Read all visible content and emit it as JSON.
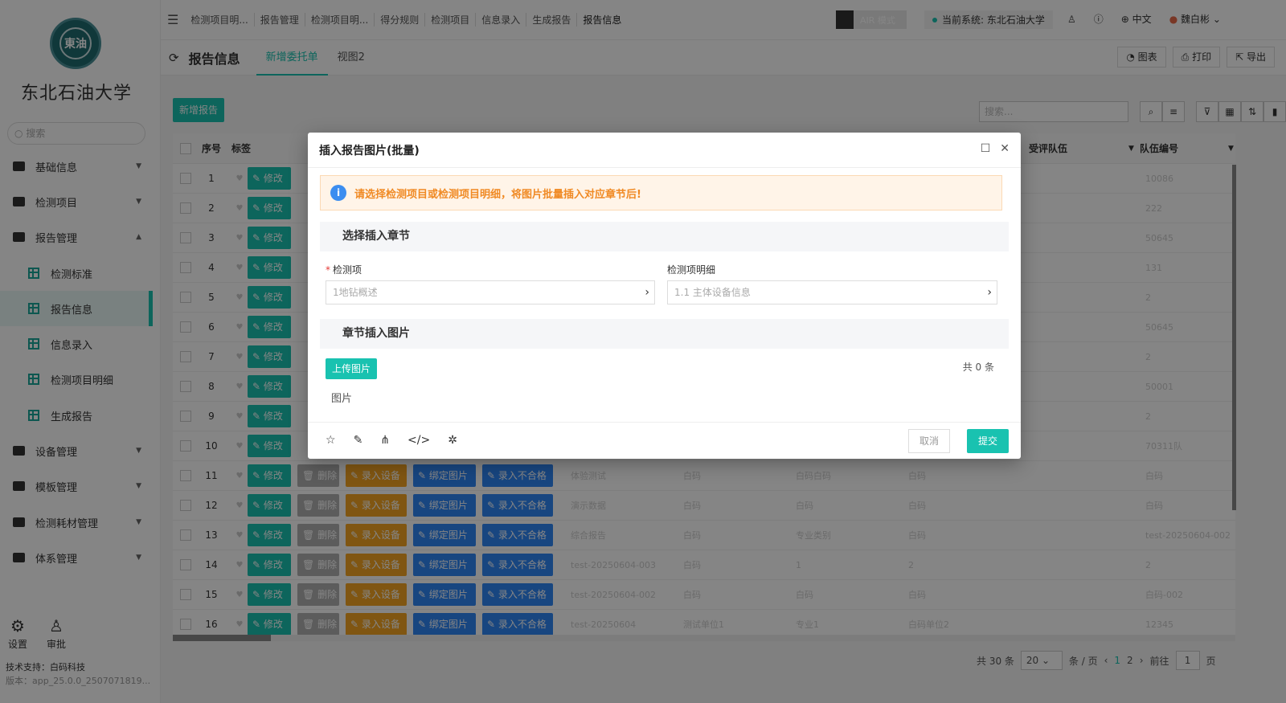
{
  "sidebar": {
    "logo_text": "東油",
    "university": "东北石油大学",
    "search_placeholder": "搜索",
    "menu": [
      {
        "label": "基础信息"
      },
      {
        "label": "检测项目"
      },
      {
        "label": "报告管理"
      },
      {
        "label": "设备管理"
      },
      {
        "label": "模板管理"
      },
      {
        "label": "检测耗材管理"
      },
      {
        "label": "体系管理"
      }
    ],
    "submenu": [
      {
        "label": "检测标准"
      },
      {
        "label": "报告信息"
      },
      {
        "label": "信息录入"
      },
      {
        "label": "检测项目明细"
      },
      {
        "label": "生成报告"
      }
    ],
    "settings": "设置",
    "approve": "审批",
    "support": "技术支持：白码科技",
    "version": "版本：app_25.0.0_2507071819..."
  },
  "topbar": {
    "crumbs": [
      "检测项目明...",
      "报告管理",
      "检测项目明...",
      "得分规则",
      "检测项目",
      "信息录入",
      "生成报告",
      "报告信息"
    ],
    "air_mode": "AIR 模式",
    "system": "当前系统: 东北石油大学",
    "lang": "中文",
    "user": "魏白彬"
  },
  "tabbar": {
    "title": "报告信息",
    "tabs": [
      "新增委托单",
      "视图2"
    ],
    "chart_btn": "图表",
    "print_btn": "打印",
    "export_btn": "导出"
  },
  "toolbar": {
    "add_report": "新增报告",
    "search_placeholder": "搜索..."
  },
  "grid": {
    "headers": {
      "seq": "序号",
      "tag": "标签",
      "team": "受评队伍",
      "team_no": "队伍编号"
    },
    "actions": {
      "edit": "修改",
      "delete": "删除",
      "device": "录入设备",
      "bind": "绑定图片",
      "ng": "录入不合格"
    },
    "rows": [
      {
        "seq": "1",
        "c1": "",
        "c2": "",
        "c3": "",
        "c4": "",
        "team_no": "10086"
      },
      {
        "seq": "2",
        "c1": "",
        "c2": "",
        "c3": "",
        "c4": "",
        "team_no": "222"
      },
      {
        "seq": "3",
        "c1": "",
        "c2": "",
        "c3": "",
        "c4": "",
        "team_no": "50645"
      },
      {
        "seq": "4",
        "c1": "",
        "c2": "",
        "c3": "",
        "c4": "",
        "team_no": "131"
      },
      {
        "seq": "5",
        "c1": "",
        "c2": "",
        "c3": "",
        "c4": "",
        "team_no": "2"
      },
      {
        "seq": "6",
        "c1": "",
        "c2": "",
        "c3": "",
        "c4": "",
        "team_no": "50645"
      },
      {
        "seq": "7",
        "c1": "",
        "c2": "",
        "c3": "",
        "c4": "",
        "team_no": "2"
      },
      {
        "seq": "8",
        "c1": "",
        "c2": "",
        "c3": "",
        "c4": "",
        "team_no": "50001"
      },
      {
        "seq": "9",
        "c1": "",
        "c2": "",
        "c3": "",
        "c4": "",
        "team_no": "2"
      },
      {
        "seq": "10",
        "c1": "",
        "c2": "",
        "c3": "",
        "c4": "",
        "team_no": "70311队"
      },
      {
        "seq": "11",
        "c1": "体验测试",
        "c2": "白码",
        "c3": "白码白码",
        "c4": "白码",
        "team_no": "白码"
      },
      {
        "seq": "12",
        "c1": "演示数据",
        "c2": "白码",
        "c3": "白码",
        "c4": "白码",
        "team_no": "白码"
      },
      {
        "seq": "13",
        "c1": "综合报告",
        "c2": "白码",
        "c3": "专业类别",
        "c4": "白码",
        "team_no": "test-20250604-002"
      },
      {
        "seq": "14",
        "c1": "test-20250604-003",
        "c2": "白码",
        "c3": "1",
        "c4": "2",
        "team_no": "2"
      },
      {
        "seq": "15",
        "c1": "test-20250604-002",
        "c2": "白码",
        "c3": "白码",
        "c4": "白码",
        "team_no": "白码-002"
      },
      {
        "seq": "16",
        "c1": "test-20250604",
        "c2": "测试单位1",
        "c3": "专业1",
        "c4": "白码单位2",
        "team_no": "12345"
      }
    ]
  },
  "pager": {
    "total": "共 30 条",
    "size": "20",
    "per_page": "条 / 页",
    "page1": "1",
    "page2": "2",
    "goto": "前往",
    "goto_value": "1",
    "page_unit": "页"
  },
  "modal": {
    "title": "插入报告图片(批量)",
    "notice": "请选择检测项目或检测项目明细，将图片批量插入对应章节后!",
    "section1": "选择插入章节",
    "field1_label": "检测项",
    "field1_value": "1地钻概述",
    "field2_label": "检测项明细",
    "field2_value": "1.1 主体设备信息",
    "section2": "章节插入图片",
    "upload": "上传图片",
    "count": "共 0 条",
    "image_label": "图片",
    "cancel": "取消",
    "submit": "提交"
  }
}
